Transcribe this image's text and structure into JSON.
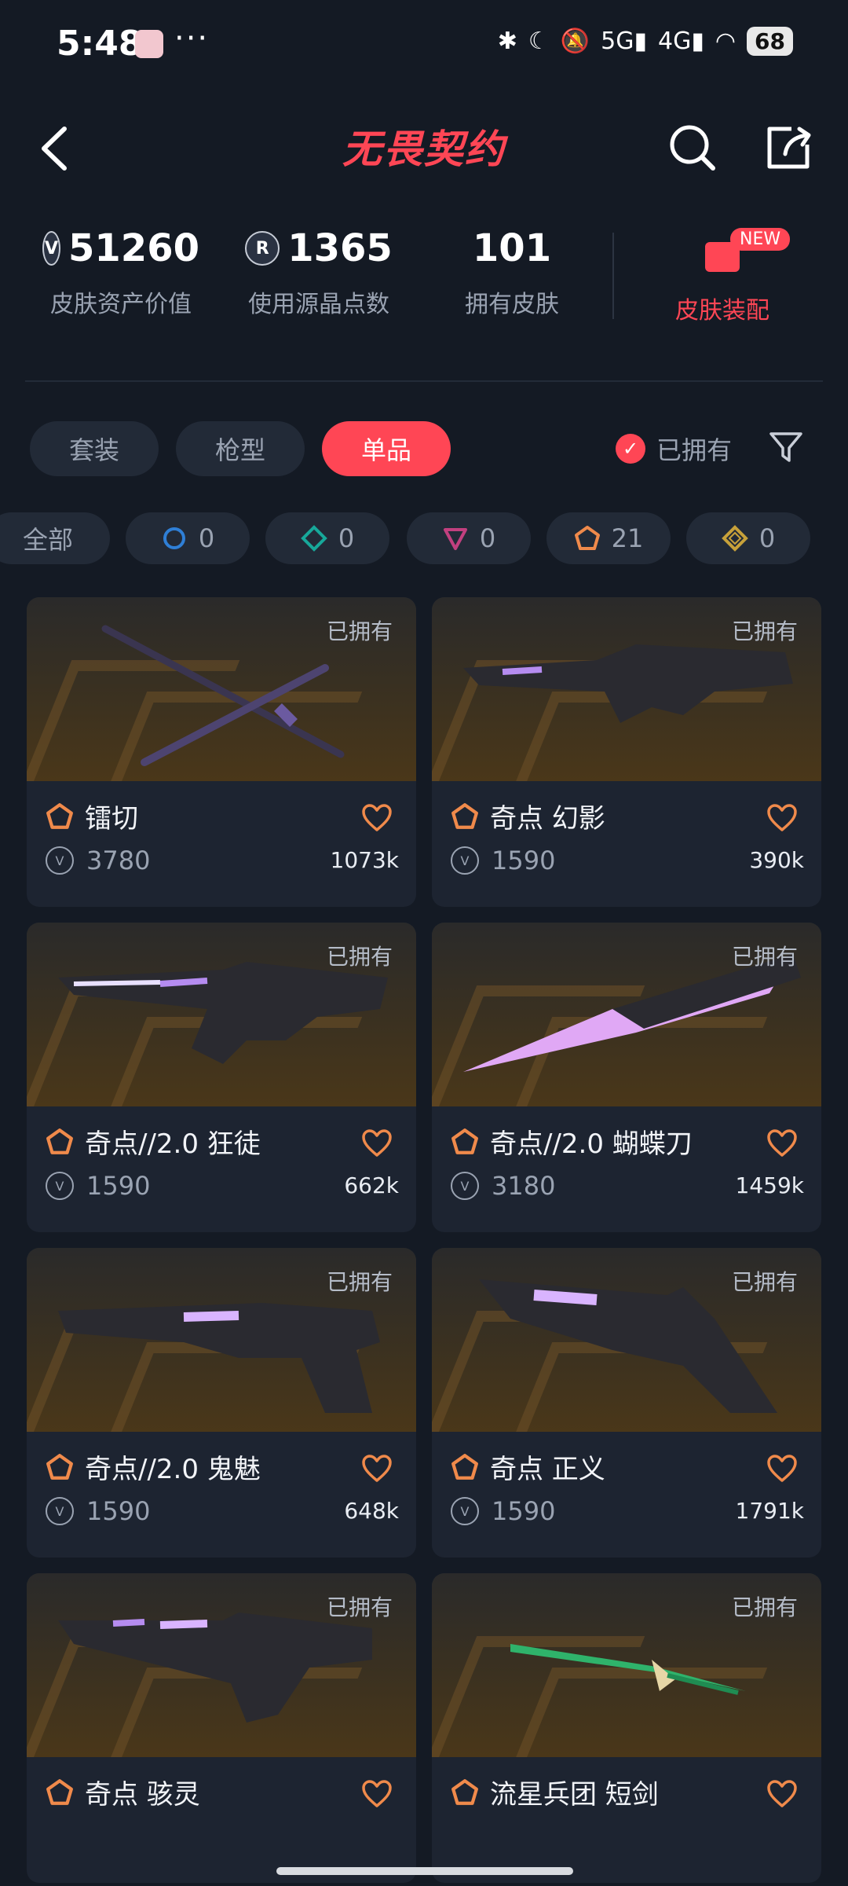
{
  "status_bar": {
    "time": "5:48",
    "more": "···",
    "battery": "68",
    "network_1": "5G",
    "network_2": "4G"
  },
  "header": {
    "title": "无畏契约"
  },
  "stats": {
    "asset_value": "51260",
    "asset_value_label": "皮肤资产价值",
    "radianite": "1365",
    "radianite_label": "使用源晶点数",
    "owned_skins": "101",
    "owned_skins_label": "拥有皮肤",
    "equip_label": "皮肤装配",
    "new_badge": "NEW"
  },
  "tabs": [
    {
      "label": "套装"
    },
    {
      "label": "枪型"
    },
    {
      "label": "单品"
    }
  ],
  "owned_filter": {
    "label": "已拥有"
  },
  "chips": [
    {
      "label": "全部",
      "count": ""
    },
    {
      "label": "",
      "count": "0",
      "color": "#2f7fd6"
    },
    {
      "label": "",
      "count": "0",
      "color": "#17a89a"
    },
    {
      "label": "",
      "count": "0",
      "color": "#c2407f"
    },
    {
      "label": "",
      "count": "21",
      "color": "#f08a4b"
    },
    {
      "label": "",
      "count": "0",
      "color": "#c7a13a"
    }
  ],
  "cards": [
    {
      "owned": "已拥有",
      "name": "镭切",
      "price": "3780",
      "likes": "1073k"
    },
    {
      "owned": "已拥有",
      "name": "奇点 幻影",
      "price": "1590",
      "likes": "390k"
    },
    {
      "owned": "已拥有",
      "name": "奇点//2.0 狂徒",
      "price": "1590",
      "likes": "662k"
    },
    {
      "owned": "已拥有",
      "name": "奇点//2.0 蝴蝶刀",
      "price": "3180",
      "likes": "1459k"
    },
    {
      "owned": "已拥有",
      "name": "奇点//2.0 鬼魅",
      "price": "1590",
      "likes": "648k"
    },
    {
      "owned": "已拥有",
      "name": "奇点 正义",
      "price": "1590",
      "likes": "1791k"
    },
    {
      "owned": "已拥有",
      "name": "奇点 骇灵",
      "price": "",
      "likes": ""
    },
    {
      "owned": "已拥有",
      "name": "流星兵团 短剑",
      "price": "",
      "likes": ""
    }
  ],
  "colors": {
    "accent": "#ff4655",
    "background": "#141a24",
    "card": "#1d2431"
  }
}
